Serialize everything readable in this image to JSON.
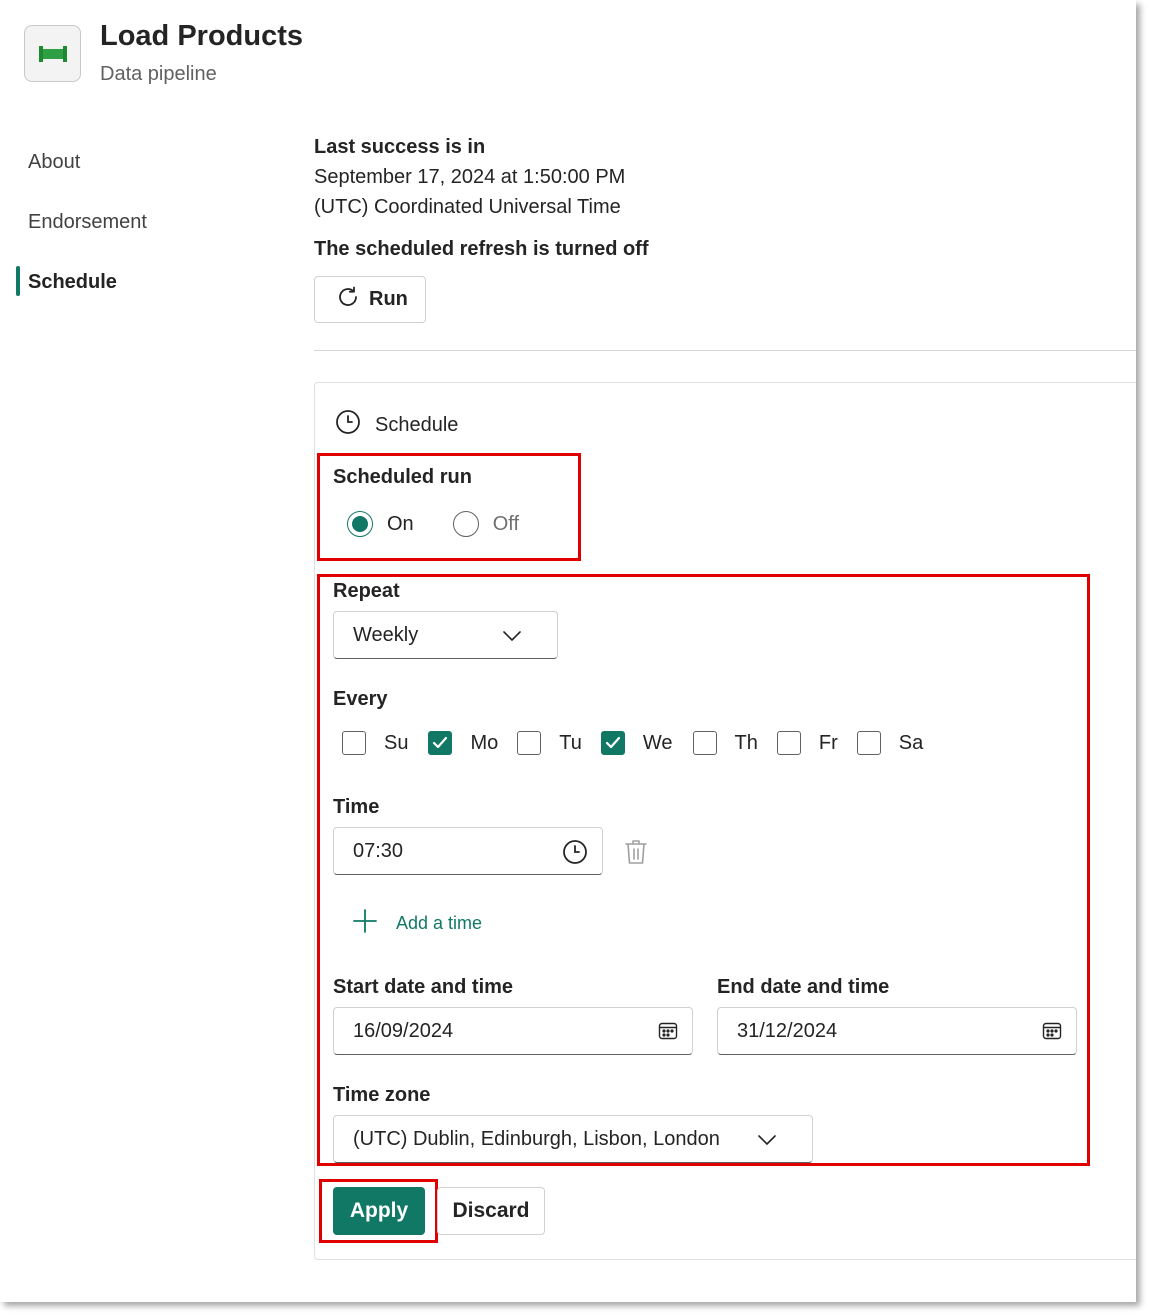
{
  "header": {
    "title": "Load Products",
    "subtitle": "Data pipeline",
    "icon": "pipeline-icon"
  },
  "nav": {
    "items": [
      {
        "label": "About",
        "active": false
      },
      {
        "label": "Endorsement",
        "active": false
      },
      {
        "label": "Schedule",
        "active": true
      }
    ]
  },
  "info": {
    "last_success_label": "Last success is in",
    "last_success_datetime": "September 17, 2024 at 1:50:00 PM",
    "last_success_timezone": "(UTC) Coordinated Universal Time",
    "refresh_status": "The scheduled refresh is turned off",
    "run_label": "Run"
  },
  "schedule": {
    "title": "Schedule",
    "scheduled_run_label": "Scheduled run",
    "on_label": "On",
    "off_label": "Off",
    "scheduled_run_value": "On",
    "repeat_label": "Repeat",
    "repeat_value": "Weekly",
    "every_label": "Every",
    "days": [
      {
        "label": "Su",
        "checked": false
      },
      {
        "label": "Mo",
        "checked": true
      },
      {
        "label": "Tu",
        "checked": false
      },
      {
        "label": "We",
        "checked": true
      },
      {
        "label": "Th",
        "checked": false
      },
      {
        "label": "Fr",
        "checked": false
      },
      {
        "label": "Sa",
        "checked": false
      }
    ],
    "time_label": "Time",
    "time_value": "07:30",
    "add_time_label": "Add a time",
    "start_label": "Start date and time",
    "start_value": "16/09/2024",
    "end_label": "End date and time",
    "end_value": "31/12/2024",
    "timezone_label": "Time zone",
    "timezone_value": "(UTC) Dublin, Edinburgh, Lisbon, London"
  },
  "actions": {
    "apply_label": "Apply",
    "discard_label": "Discard"
  },
  "colors": {
    "accent": "#117865",
    "highlight": "#e00000"
  }
}
